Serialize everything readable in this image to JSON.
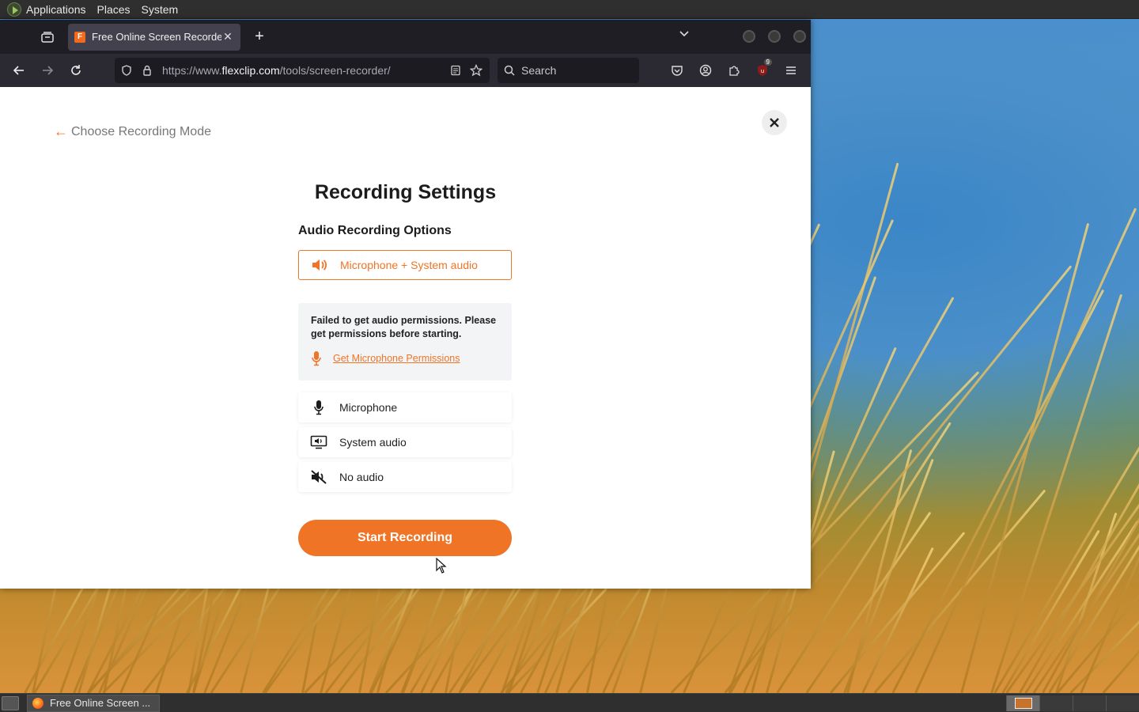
{
  "top_panel": {
    "menus": [
      "Applications",
      "Places",
      "System"
    ]
  },
  "browser": {
    "tab": {
      "title": "Free Online Screen Recorder",
      "favicon": "F"
    },
    "url": {
      "prefix": "https://www.",
      "domain": "flexclip.com",
      "path": "/tools/screen-recorder/"
    },
    "search_placeholder": "Search",
    "extension_badge": "9"
  },
  "page": {
    "back_label": "Choose Recording Mode",
    "title": "Recording Settings",
    "section_label": "Audio Recording Options",
    "selected_option": "Microphone + System audio",
    "permission_message": "Failed to get audio permissions. Please get permissions before starting.",
    "permission_link": "Get Microphone Permissions",
    "options": [
      "Microphone",
      "System audio",
      "No audio"
    ],
    "start_button": "Start Recording"
  },
  "taskbar": {
    "window_title": "Free Online Screen ..."
  },
  "colors": {
    "accent": "#f07426",
    "tab_bg": "#42414d",
    "toolbar_bg": "#2b2a33"
  }
}
